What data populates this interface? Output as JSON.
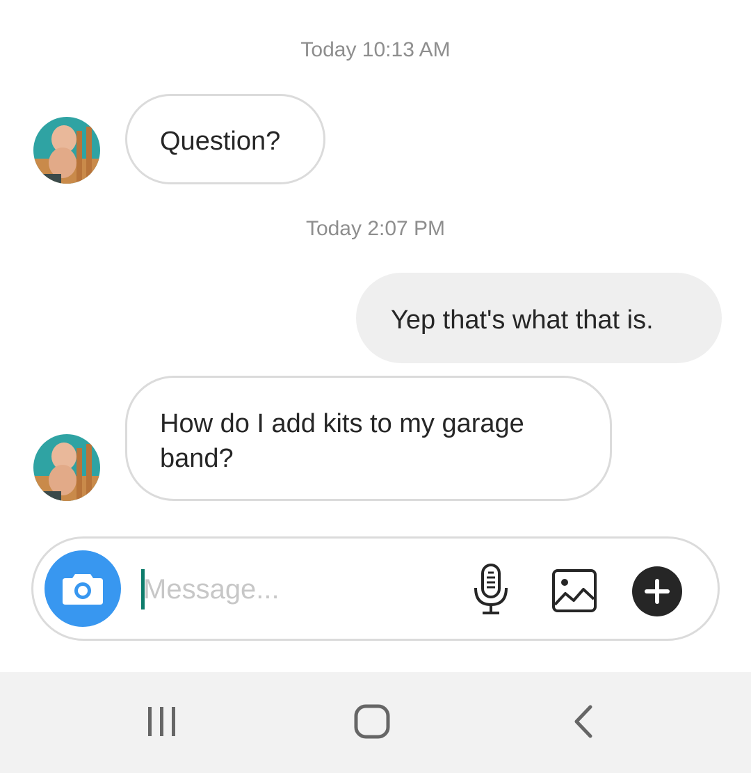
{
  "conversation": {
    "timestamps": [
      "Today 10:13 AM",
      "Today 2:07 PM"
    ],
    "messages": [
      {
        "direction": "incoming",
        "text": "Question?"
      },
      {
        "direction": "outgoing",
        "text": "Yep that's what that is."
      },
      {
        "direction": "incoming",
        "text": "How do I add kits to my garage band?"
      }
    ]
  },
  "composer": {
    "placeholder": "Message...",
    "value": "",
    "icons": [
      "camera-icon",
      "microphone-icon",
      "gallery-icon",
      "plus-icon"
    ]
  },
  "navbar": {
    "icons": [
      "recent-apps-icon",
      "home-icon",
      "back-icon"
    ]
  },
  "colors": {
    "camera_button": "#3897f0",
    "incoming_border": "#dbdbdb",
    "outgoing_bg": "#efefef",
    "caret": "#0e7c6b",
    "timestamp_text": "#8e8e8e",
    "navbar_bg": "#f2f2f2"
  }
}
